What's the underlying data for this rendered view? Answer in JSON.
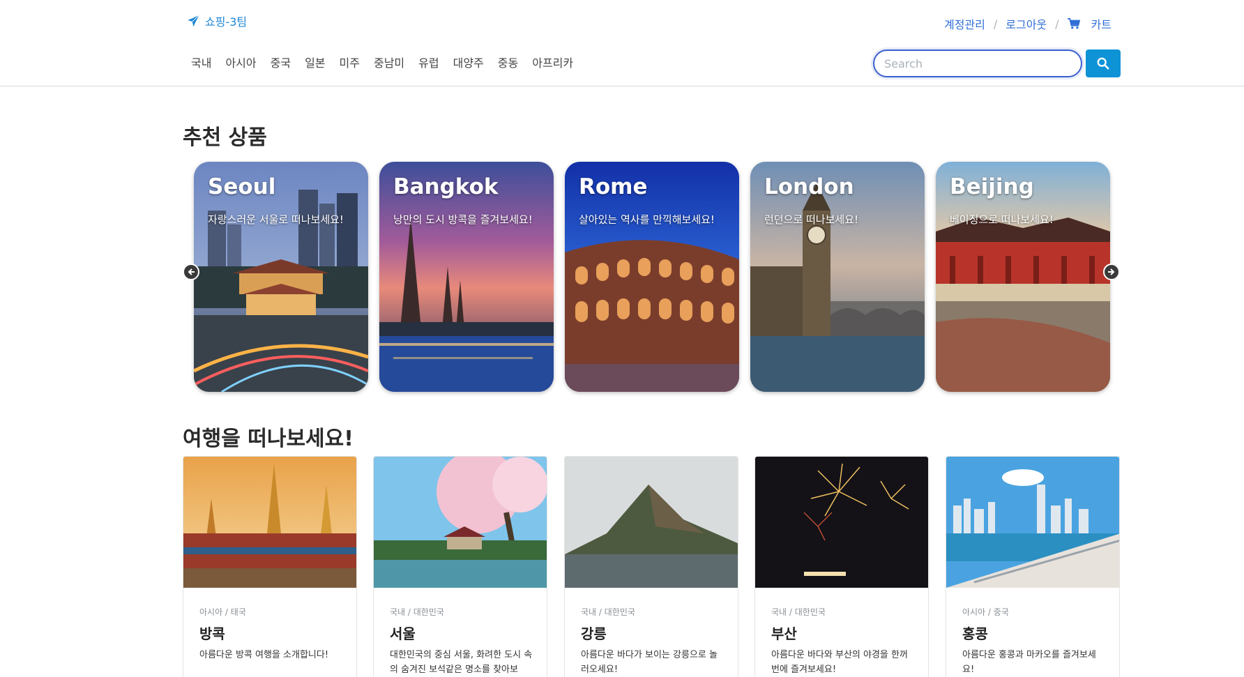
{
  "header": {
    "logo_text": "쇼핑-3팀",
    "account_link": "계정관리",
    "logout_link": "로그아웃",
    "cart_link": "카트",
    "separator": "/"
  },
  "nav": {
    "items": [
      "국내",
      "아시아",
      "중국",
      "일본",
      "미주",
      "중남미",
      "유럽",
      "대양주",
      "중동",
      "아프리카"
    ]
  },
  "search": {
    "placeholder": "Search",
    "value": ""
  },
  "recommended": {
    "title": "추천 상품",
    "slides": [
      {
        "city": "Seoul",
        "desc": "자랑스러운 서울로 떠나보세요!"
      },
      {
        "city": "Bangkok",
        "desc": "낭만의 도시 방콕을 즐겨보세요!"
      },
      {
        "city": "Rome",
        "desc": "살아있는 역사를 만끽해보세요!"
      },
      {
        "city": "London",
        "desc": "런던으로 떠나보세요!"
      },
      {
        "city": "Beijing",
        "desc": "베이징으로 떠나보세요!"
      }
    ]
  },
  "travel": {
    "title": "여행을 떠나보세요!",
    "cards": [
      {
        "meta": "아시아 / 태국",
        "name": "방콕",
        "text": "아름다운 방콕 여행을 소개합니다!"
      },
      {
        "meta": "국내 / 대한민국",
        "name": "서울",
        "text": "대한민국의 중심 서울, 화려한 도시 속의 숨겨진 보석같은 명소를 찾아보"
      },
      {
        "meta": "국내 / 대한민국",
        "name": "강릉",
        "text": "아름다운 바다가 보이는 강릉으로 놀러오세요!"
      },
      {
        "meta": "국내 / 대한민국",
        "name": "부산",
        "text": "아름다운 바다와 부산의 야경을 한꺼번에 즐겨보세요!"
      },
      {
        "meta": "아시아 / 중국",
        "name": "홍콩",
        "text": "아름다운 홍콩과 마카오를 즐겨보세요!"
      }
    ]
  },
  "colors": {
    "link": "#2f6fd6",
    "search_button": "#0d93d6",
    "logo": "#1f87d6"
  }
}
